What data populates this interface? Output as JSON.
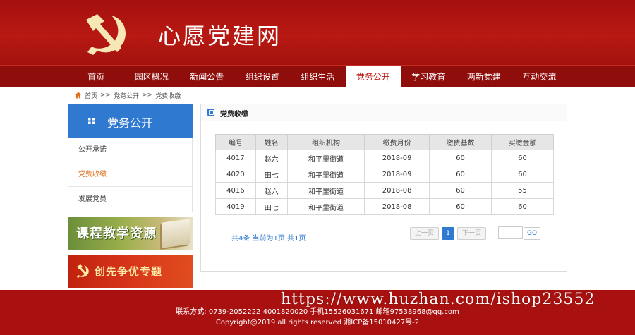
{
  "site": {
    "title": "心愿党建网"
  },
  "nav": {
    "items": [
      "首页",
      "园区概况",
      "新闻公告",
      "组织设置",
      "组织生活",
      "党务公开",
      "学习教育",
      "两新党建",
      "互动交流"
    ],
    "active_index": 5
  },
  "breadcrumb": {
    "home": "首页",
    "sep1": ">>",
    "level1": "党务公开",
    "sep2": ">>",
    "level2": "党费收缴"
  },
  "sidebar": {
    "title": "党务公开",
    "items": [
      "公开承诺",
      "党费收缴",
      "发展党员"
    ],
    "active_index": 1,
    "banner1": "课程教学资源",
    "banner2": "创先争优专题"
  },
  "panel": {
    "title": "党费收缴"
  },
  "table": {
    "headers": [
      "编号",
      "姓名",
      "组织机构",
      "缴费月份",
      "缴费基数",
      "实缴金额"
    ],
    "rows": [
      [
        "4017",
        "赵六",
        "和平里街道",
        "2018-09",
        "60",
        "60"
      ],
      [
        "4020",
        "田七",
        "和平里街道",
        "2018-09",
        "60",
        "60"
      ],
      [
        "4016",
        "赵六",
        "和平里街道",
        "2018-08",
        "60",
        "55"
      ],
      [
        "4019",
        "田七",
        "和平里街道",
        "2018-08",
        "60",
        "60"
      ]
    ]
  },
  "pager": {
    "info": "共4条 当前为1页 共1页",
    "prev": "上一页",
    "current": "1",
    "next": "下一页",
    "go": "GO"
  },
  "footer": {
    "line1": "联系方式: 0739-2052222 4001820020 手机15526031671 邮箱97538968@qq.com",
    "line2": "Copyright@2019 all rights reserved 湘ICP备15010427号-2"
  },
  "watermark": "https://www.huzhan.com/ishop23552",
  "colors": {
    "brand_red": "#a8110f",
    "nav_red": "#8f0d0b",
    "accent_blue": "#2f79d1",
    "active_orange": "#e0701a"
  }
}
